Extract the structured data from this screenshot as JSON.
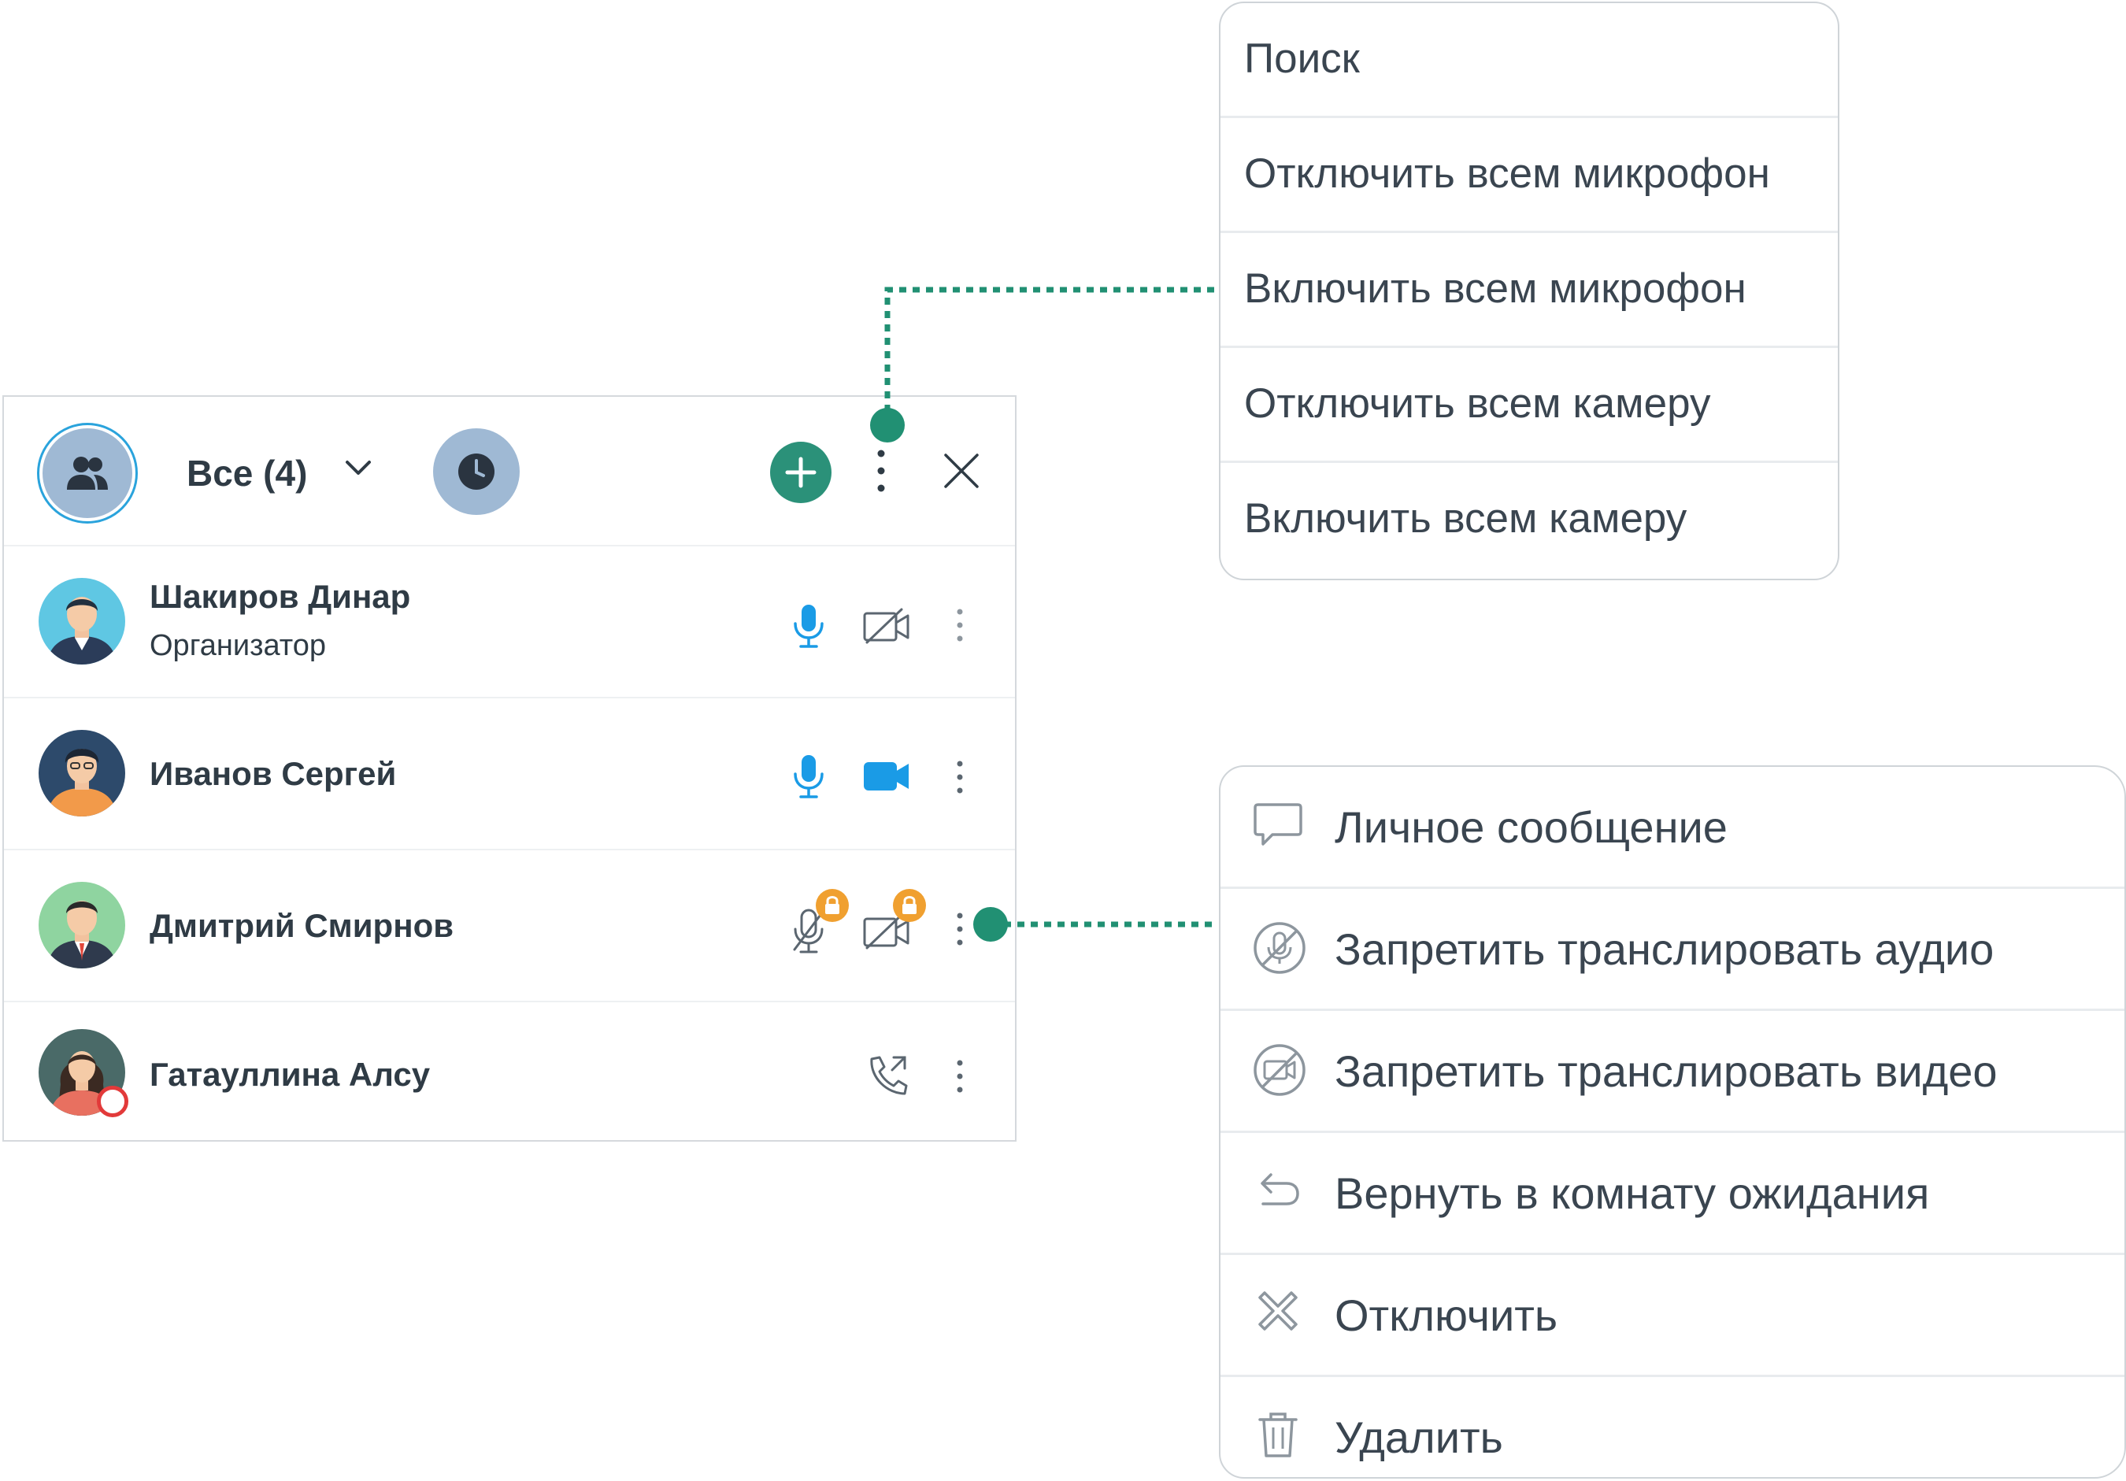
{
  "panel": {
    "filter_label": "Все (4)",
    "participants": [
      {
        "name": "Шакиров Динар",
        "role": "Организатор",
        "mic": "on",
        "camera": "off"
      },
      {
        "name": "Иванов Сергей",
        "role": "",
        "mic": "on",
        "camera": "on"
      },
      {
        "name": "Дмитрий Смирнов",
        "role": "",
        "mic": "locked",
        "camera": "locked"
      },
      {
        "name": "Гатауллина Алсу",
        "role": "",
        "mic": "none",
        "camera": "phone"
      }
    ]
  },
  "menu_all": {
    "items": [
      "Поиск",
      "Отключить всем микрофон",
      "Включить всем микрофон",
      "Отключить всем камеру",
      "Включить всем камеру"
    ]
  },
  "menu_participant": {
    "items": [
      {
        "label": "Личное сообщение",
        "icon": "message-icon"
      },
      {
        "label": "Запретить транслировать аудио",
        "icon": "mic-ban-icon"
      },
      {
        "label": "Запретить транслировать видео",
        "icon": "video-ban-icon"
      },
      {
        "label": "Вернуть в комнату ожидания",
        "icon": "return-icon"
      },
      {
        "label": "Отключить",
        "icon": "disconnect-icon"
      },
      {
        "label": "Удалить",
        "icon": "trash-icon"
      }
    ]
  },
  "colors": {
    "accent_green": "#2b9179",
    "callout_green": "#219073",
    "active_blue": "#1a9be6",
    "lock_orange": "#f0a030",
    "offline_red": "#e23a3a",
    "header_circle": "#9fb9d4"
  }
}
